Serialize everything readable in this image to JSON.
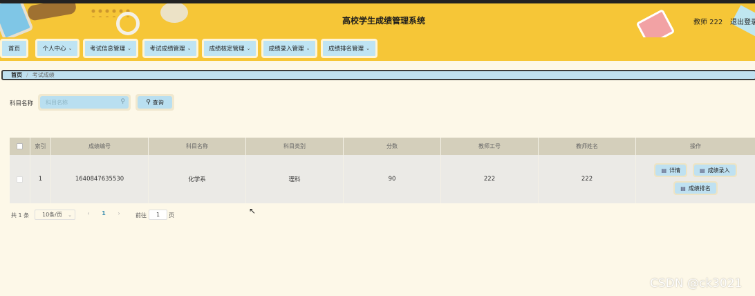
{
  "header": {
    "title": "高校学生成绩管理系统",
    "user": "教师 222",
    "logout": "退出登录"
  },
  "nav": {
    "items": [
      {
        "label": "首页",
        "has_dropdown": false
      },
      {
        "label": "个人中心",
        "has_dropdown": true
      },
      {
        "label": "考试信息管理",
        "has_dropdown": true
      },
      {
        "label": "考试成绩管理",
        "has_dropdown": true
      },
      {
        "label": "成绩核定管理",
        "has_dropdown": true
      },
      {
        "label": "成绩录入管理",
        "has_dropdown": true
      },
      {
        "label": "成绩排名管理",
        "has_dropdown": true
      }
    ]
  },
  "breadcrumb": {
    "home": "首页",
    "separator": "/",
    "current": "考试成绩"
  },
  "search": {
    "label": "科目名称",
    "placeholder": "科目名称",
    "button": "查询"
  },
  "table": {
    "columns": [
      "索引",
      "成绩编号",
      "科目名称",
      "科目类别",
      "分数",
      "教师工号",
      "教师姓名",
      "操作"
    ],
    "rows": [
      {
        "index": "1",
        "score_no": "1640847635530",
        "subject": "化学系",
        "category": "理科",
        "score": "90",
        "teacher_id": "222",
        "teacher_name": "222",
        "actions": [
          "详情",
          "成绩录入",
          "成绩排名"
        ]
      }
    ]
  },
  "pagination": {
    "total": "共 1 条",
    "page_size": "10条/页",
    "current_page": "1",
    "goto_label": "前往",
    "goto_value": "1",
    "page_unit": "页"
  },
  "watermark": "CSDN @ck3021",
  "colors": {
    "header_bg": "#f6c637",
    "button_bg": "#bfe4f3",
    "page_bg": "#fdf8e8",
    "table_header_bg": "#d4cfbb"
  }
}
